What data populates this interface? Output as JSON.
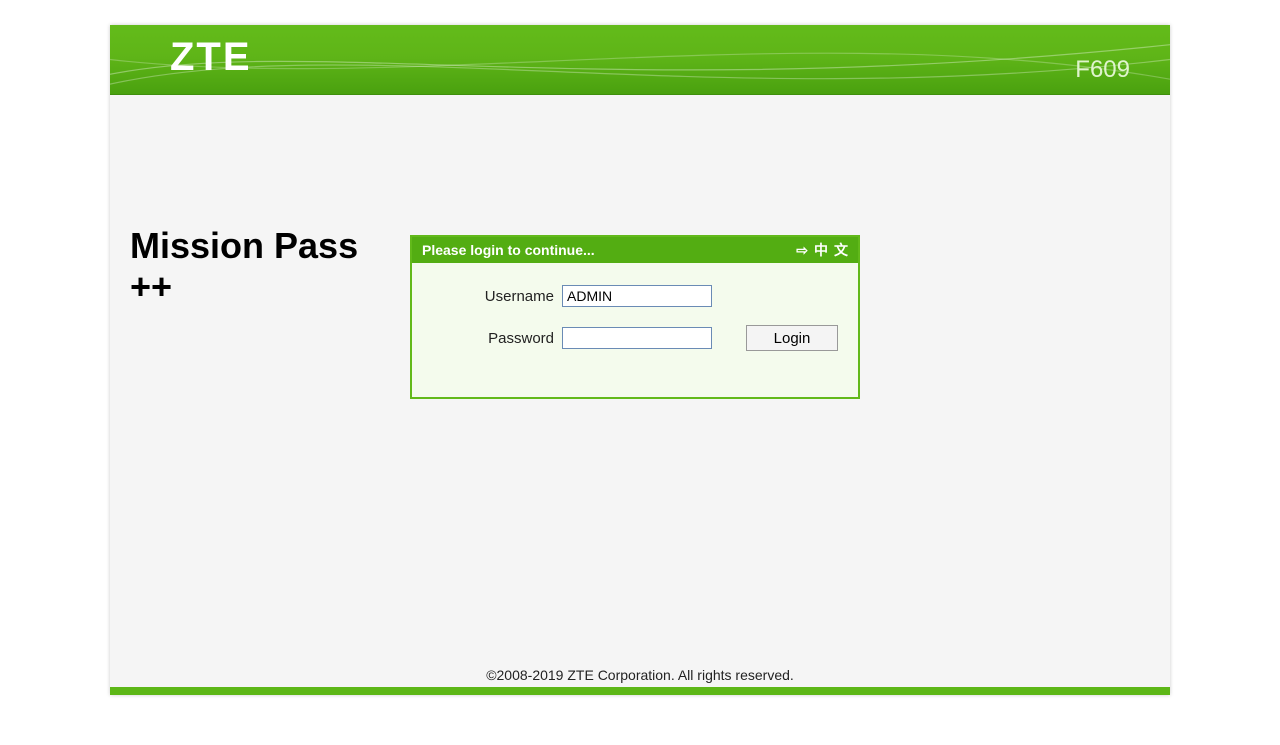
{
  "header": {
    "brand": "ZTE",
    "model": "F609"
  },
  "overlay": {
    "line1": "Mission Pass",
    "line2": "++"
  },
  "login": {
    "title": "Please login to continue...",
    "lang_arrow": "⇨",
    "lang_char1": "中",
    "lang_char2": "文",
    "username_label": "Username",
    "username_value": "ADMIN",
    "password_label": "Password",
    "password_value": "",
    "button_label": "Login"
  },
  "footer": {
    "copyright": "©2008-2019 ZTE Corporation. All rights reserved."
  }
}
